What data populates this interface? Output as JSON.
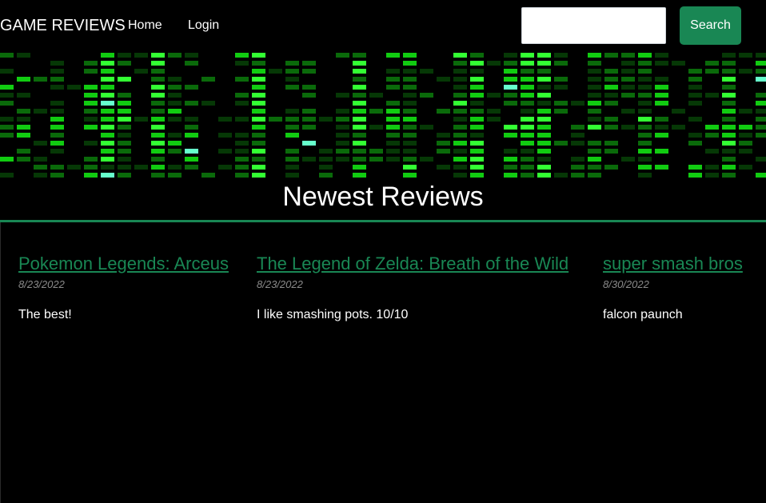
{
  "navbar": {
    "brand": "GAME REVIEWS",
    "links": [
      {
        "label": "Home"
      },
      {
        "label": "Login"
      }
    ],
    "search": {
      "value": "",
      "placeholder": "",
      "button_label": "Search"
    }
  },
  "banner": {
    "colors": {
      "background": "#000000",
      "bright": "#33ff33",
      "mid": "#11cc11",
      "dim": "#0a6a0a",
      "faint": "#063806",
      "highlight": "#66ffcc"
    }
  },
  "main": {
    "title": "Newest Reviews",
    "reviews": [
      {
        "title": "Pokemon Legends: Arceus",
        "date": "8/23/2022",
        "text": "The best!"
      },
      {
        "title": "The Legend of Zelda: Breath of the Wild",
        "date": "8/23/2022",
        "text": "I like smashing pots. 10/10"
      },
      {
        "title": "super smash bros",
        "date": "8/30/2022",
        "text": "falcon paunch"
      }
    ]
  },
  "colors": {
    "background": "#000000",
    "accent": "#198754",
    "text": "#ffffff",
    "muted": "#8a8a8a"
  }
}
